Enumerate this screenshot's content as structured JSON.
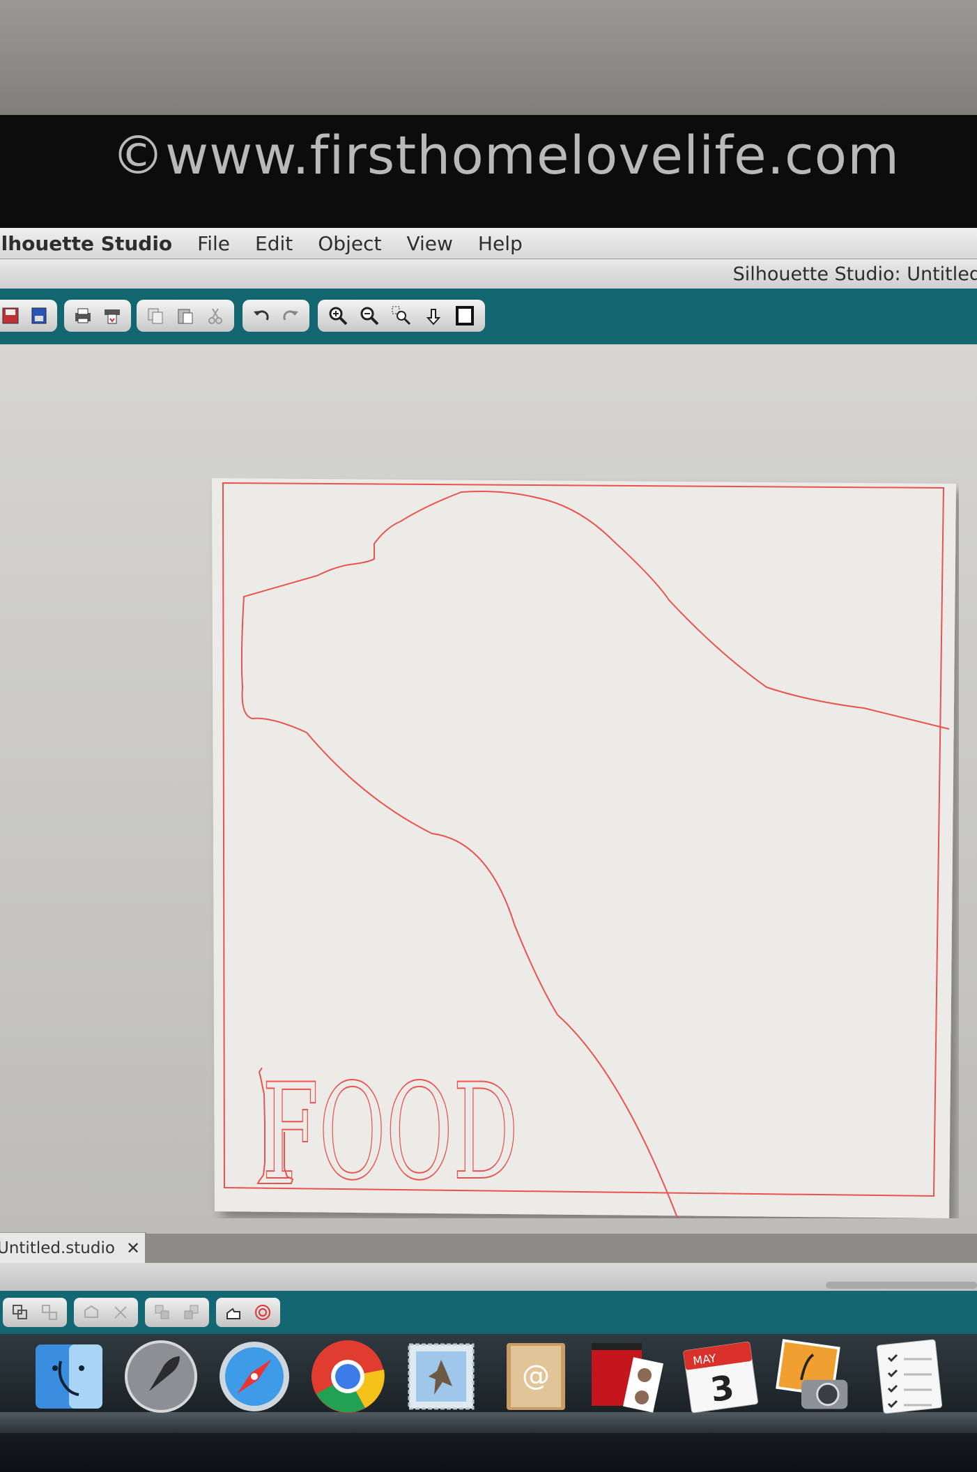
{
  "watermark": "©www.firsthomelovelife.com",
  "menubar": {
    "app_name": "ilhouette Studio",
    "menus": [
      "File",
      "Edit",
      "Object",
      "View",
      "Help"
    ]
  },
  "window": {
    "title": "Silhouette Studio: Untitled"
  },
  "toolbar": {
    "groups": [
      [
        "save-icon",
        "save-to-library-icon"
      ],
      [
        "print-icon",
        "send-to-silhouette-icon"
      ],
      [
        "copy-icon",
        "paste-icon",
        "cut-icon"
      ],
      [
        "undo-icon",
        "redo-icon"
      ],
      [
        "zoom-in-icon",
        "zoom-out-icon",
        "zoom-select-icon",
        "pan-icon",
        "fit-to-page-icon"
      ]
    ]
  },
  "canvas": {
    "design_text": "FOOD",
    "cut_line_color": "#e8534f",
    "accent_color": "#116670"
  },
  "document_tab": {
    "name": "Untitled.studio",
    "close": "✕"
  },
  "bottom_toolbar": {
    "groups": [
      [
        "group-icon",
        "ungroup-icon"
      ],
      [
        "compound-path-icon",
        "release-compound-icon"
      ],
      [
        "bring-forward-icon",
        "send-backward-icon"
      ],
      [
        "weld-icon",
        "offset-icon"
      ]
    ]
  },
  "dock": {
    "items": [
      "finder-icon",
      "launchpad-icon",
      "safari-icon",
      "chrome-icon",
      "mail-icon",
      "address-book-icon",
      "photo-booth-icon",
      "calendar-icon",
      "iphoto-icon",
      "reminders-icon"
    ],
    "calendar": {
      "month": "MAY",
      "day": "3"
    }
  }
}
